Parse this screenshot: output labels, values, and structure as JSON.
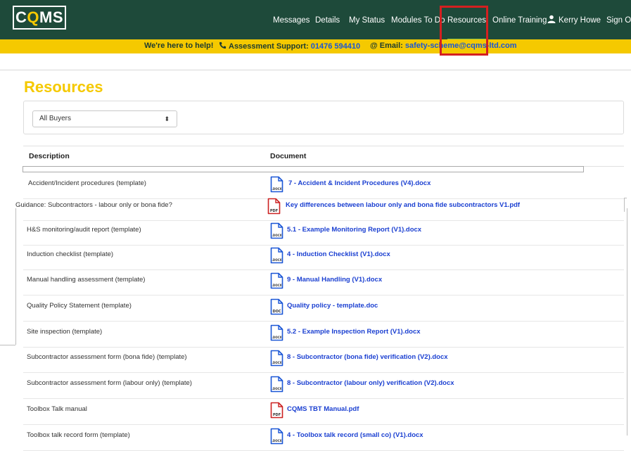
{
  "nav": {
    "logo_text_left": "C",
    "logo_text_q": "Q",
    "logo_text_right": "MS",
    "links": {
      "messages": "Messages",
      "details": "Details",
      "my_status": "My Status",
      "modules": "Modules To Do",
      "resources": "Resources",
      "training": "Online Training",
      "user": "Kerry Howe",
      "signout": "Sign Out"
    },
    "active": "Resources"
  },
  "helpbar": {
    "tagline": "We're here to help!",
    "support_label": "Assessment Support:",
    "support_phone": "01476 594410",
    "email_label": "@ Email:",
    "email": "safety-scheme@cqms-ltd.com"
  },
  "page": {
    "title": "Resources",
    "filter_selected": "All Buyers"
  },
  "table": {
    "headers": {
      "description": "Description",
      "document": "Document"
    },
    "rows": [
      {
        "description": "Accident/Incident procedures (template)",
        "document": "7 - Accident & Incident Procedures (V4).docx",
        "type": "docx"
      },
      {
        "description": "Guidance: Subcontractors - labour only or bona fide?",
        "document": "Key differences between labour only and bona fide subcontractors V1.pdf",
        "type": "pdf"
      },
      {
        "description": "H&S monitoring/audit report (template)",
        "document": "5.1 - Example Monitoring Report (V1).docx",
        "type": "docx"
      },
      {
        "description": "Induction checklist (template)",
        "document": "4 - Induction Checklist (V1).docx",
        "type": "docx"
      },
      {
        "description": "Manual handling assessment (template)",
        "document": "9 - Manual Handling (V1).docx",
        "type": "docx"
      },
      {
        "description": "Quality Policy Statement (template)",
        "document": "Quality policy - template.doc",
        "type": "doc"
      },
      {
        "description": "Site inspection (template)",
        "document": "5.2 - Example Inspection Report (V1).docx",
        "type": "docx"
      },
      {
        "description": "Subcontractor assessment form (bona fide) (template)",
        "document": "8 - Subcontractor (bona fide) verification (V2).docx",
        "type": "docx"
      },
      {
        "description": "Subcontractor assessment form (labour only) (template)",
        "document": "8 - Subcontractor (labour only) verification (V2).docx",
        "type": "docx"
      },
      {
        "description": "Toolbox Talk manual",
        "document": "CQMS TBT Manual.pdf",
        "type": "pdf"
      },
      {
        "description": "Toolbox talk record form (template)",
        "document": "4 - Toolbox talk record (small co) (V1).docx",
        "type": "docx"
      }
    ]
  },
  "colors": {
    "nav_bg": "#1e4a3a",
    "accent_yellow": "#f5c900",
    "link_blue": "#1a3fd1",
    "pdf_red": "#cc2222",
    "doc_blue": "#1a56d6",
    "highlight_red": "#d42020"
  },
  "icons": {
    "user": "user-icon",
    "phone": "phone-icon",
    "select_arrow": "sort-arrows-icon",
    "docx": "word-docx-icon",
    "doc": "word-doc-icon",
    "pdf": "pdf-icon"
  }
}
